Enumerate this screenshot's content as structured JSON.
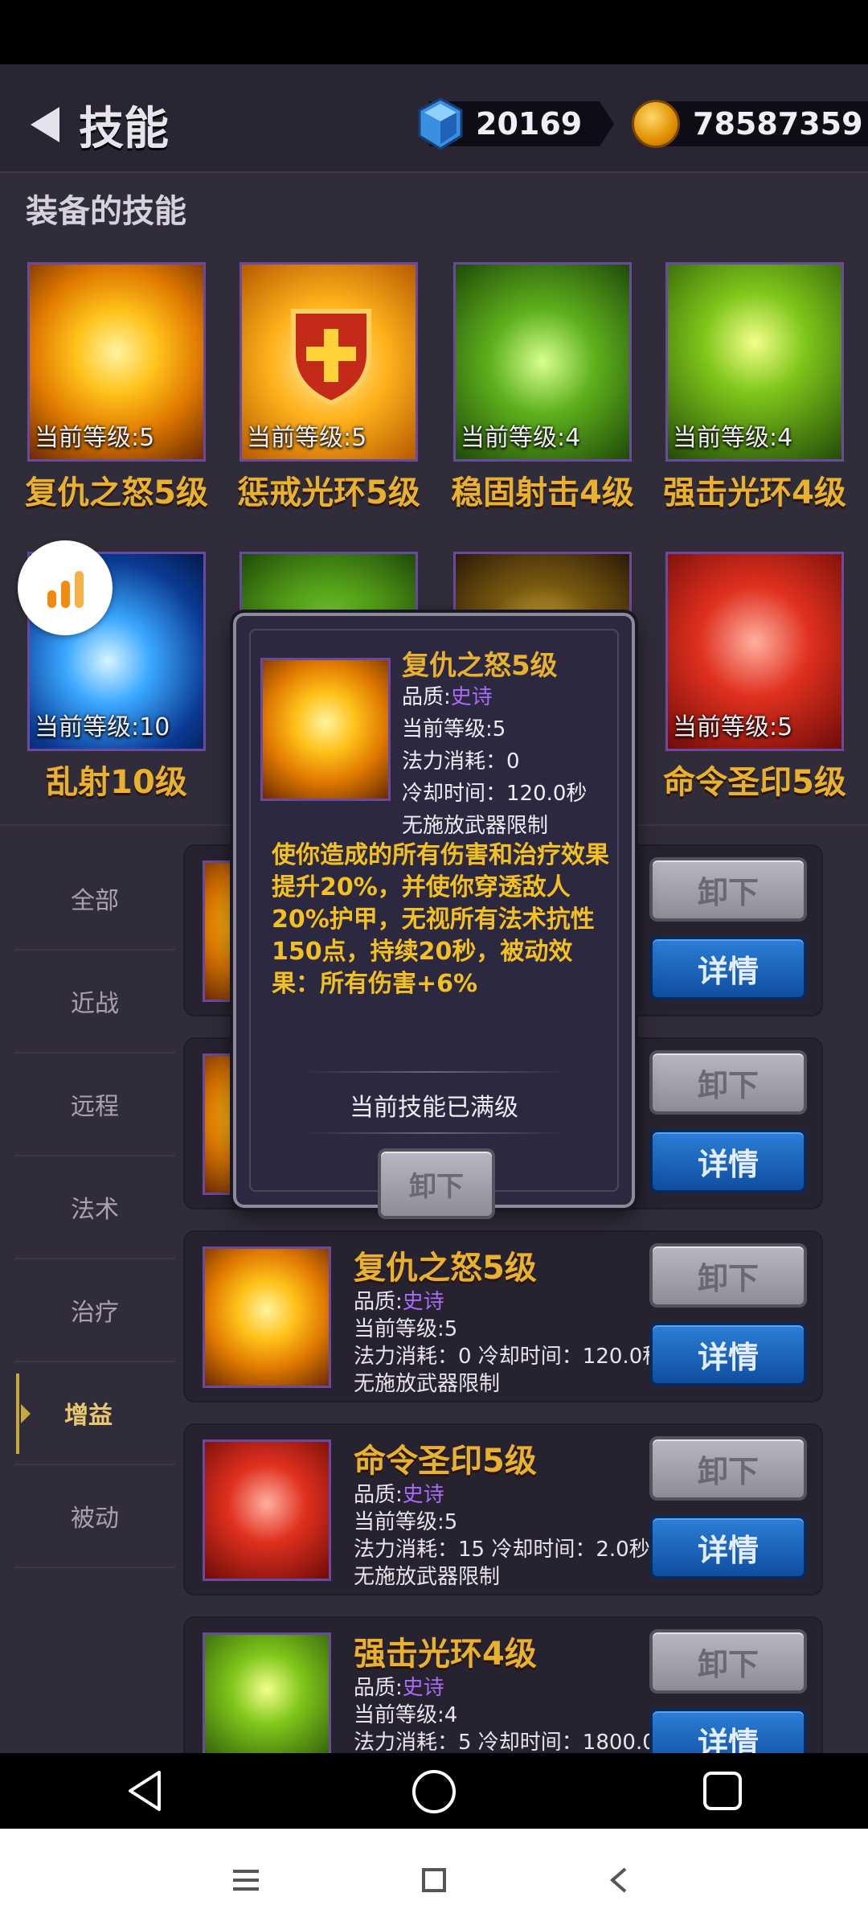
{
  "header": {
    "title": "技能",
    "gems": "20169",
    "coins": "78587359"
  },
  "equipped": {
    "section_title": "装备的技能",
    "skills": [
      {
        "name": "复仇之怒5级",
        "level": "当前等级:5",
        "art": "fire"
      },
      {
        "name": "惩戒光环5级",
        "level": "当前等级:5",
        "art": "shield"
      },
      {
        "name": "稳固射击4级",
        "level": "当前等级:4",
        "art": "green"
      },
      {
        "name": "强击光环4级",
        "level": "当前等级:4",
        "art": "halo"
      },
      {
        "name": "乱射10级",
        "level": "当前等级:10",
        "art": "blue"
      },
      {
        "name": "",
        "level": "",
        "art": "green"
      },
      {
        "name": "",
        "level": "",
        "art": "dark"
      },
      {
        "name": "命令圣印5级",
        "level": "当前等级:5",
        "art": "red"
      }
    ]
  },
  "filters": [
    "全部",
    "近战",
    "远程",
    "法术",
    "治疗",
    "增益",
    "被动"
  ],
  "active_filter": "增益",
  "list": [
    {
      "name": "复仇之怒5级",
      "quality_label": "品质:",
      "quality": "史诗",
      "level": "当前等级:5",
      "cost": "法力消耗：0 冷却时间：120.0秒",
      "restriction": "无施放武器限制",
      "art": "fire"
    },
    {
      "name": "命令圣印5级",
      "quality_label": "品质:",
      "quality": "史诗",
      "level": "当前等级:5",
      "cost": "法力消耗：15 冷却时间：2.0秒",
      "restriction": "无施放武器限制",
      "art": "red"
    },
    {
      "name": "强击光环4级",
      "quality_label": "品质:",
      "quality": "史诗",
      "level": "当前等级:4",
      "cost": "法力消耗：5 冷却时间：1800.0秒",
      "restriction": "",
      "art": "halo"
    }
  ],
  "buttons": {
    "unequip": "卸下",
    "details": "详情"
  },
  "modal": {
    "name": "复仇之怒5级",
    "quality_label": "品质:",
    "quality": "史诗",
    "level": "当前等级:5",
    "mana": "法力消耗：0",
    "cooldown": "冷却时间：120.0秒",
    "restriction": "无施放武器限制",
    "description": "使你造成的所有伤害和治疗效果提升20%，并使你穿透敌人20%护甲，无视所有法术抗性150点，持续20秒，被动效果：所有伤害+6%",
    "maxed": "当前技能已满级",
    "button": "卸下"
  },
  "colors": {
    "gold_text": "#e8b230",
    "epic_purple": "#a86cf2",
    "desc_yellow": "#f2c020"
  }
}
